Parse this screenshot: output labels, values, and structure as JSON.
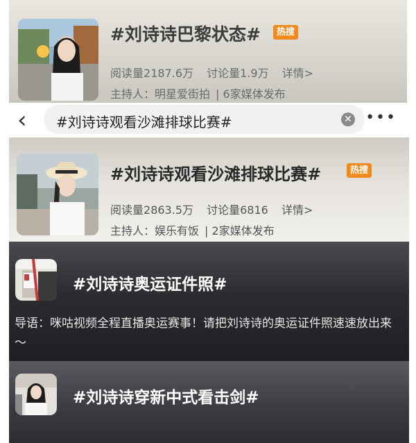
{
  "topics": [
    {
      "title": "#刘诗诗巴黎状态#",
      "badge": "热搜",
      "reads_label": "阅读量",
      "reads": "2187.6万",
      "discuss_label": "讨论量",
      "discuss": "1.9万",
      "details": "详情>",
      "host_label": "主持人：",
      "host": "明星爱街拍",
      "media": "| 6家媒体发布"
    },
    {
      "title": "#刘诗诗观看沙滩排球比赛#",
      "badge": "热搜",
      "reads_label": "阅读量",
      "reads": "2863.5万",
      "discuss_label": "讨论量",
      "discuss": "6816",
      "details": "详情>",
      "host_label": "主持人：",
      "host": "娱乐有饭",
      "media": "| 2家媒体发布"
    },
    {
      "title": "#刘诗诗奥运证件照#",
      "intro": "导语：咪咕视频全程直播奥运赛事！请把刘诗诗的奥运证件照速速放出来～"
    },
    {
      "title": "#刘诗诗穿新中式看击剑#"
    }
  ],
  "search": {
    "query": "#刘诗诗观看沙滩排球比赛#",
    "back_icon": "chevron-left-icon",
    "clear_icon": "clear-icon",
    "more_icon": "more-icon"
  },
  "colors": {
    "badge": "#f08a1c"
  }
}
